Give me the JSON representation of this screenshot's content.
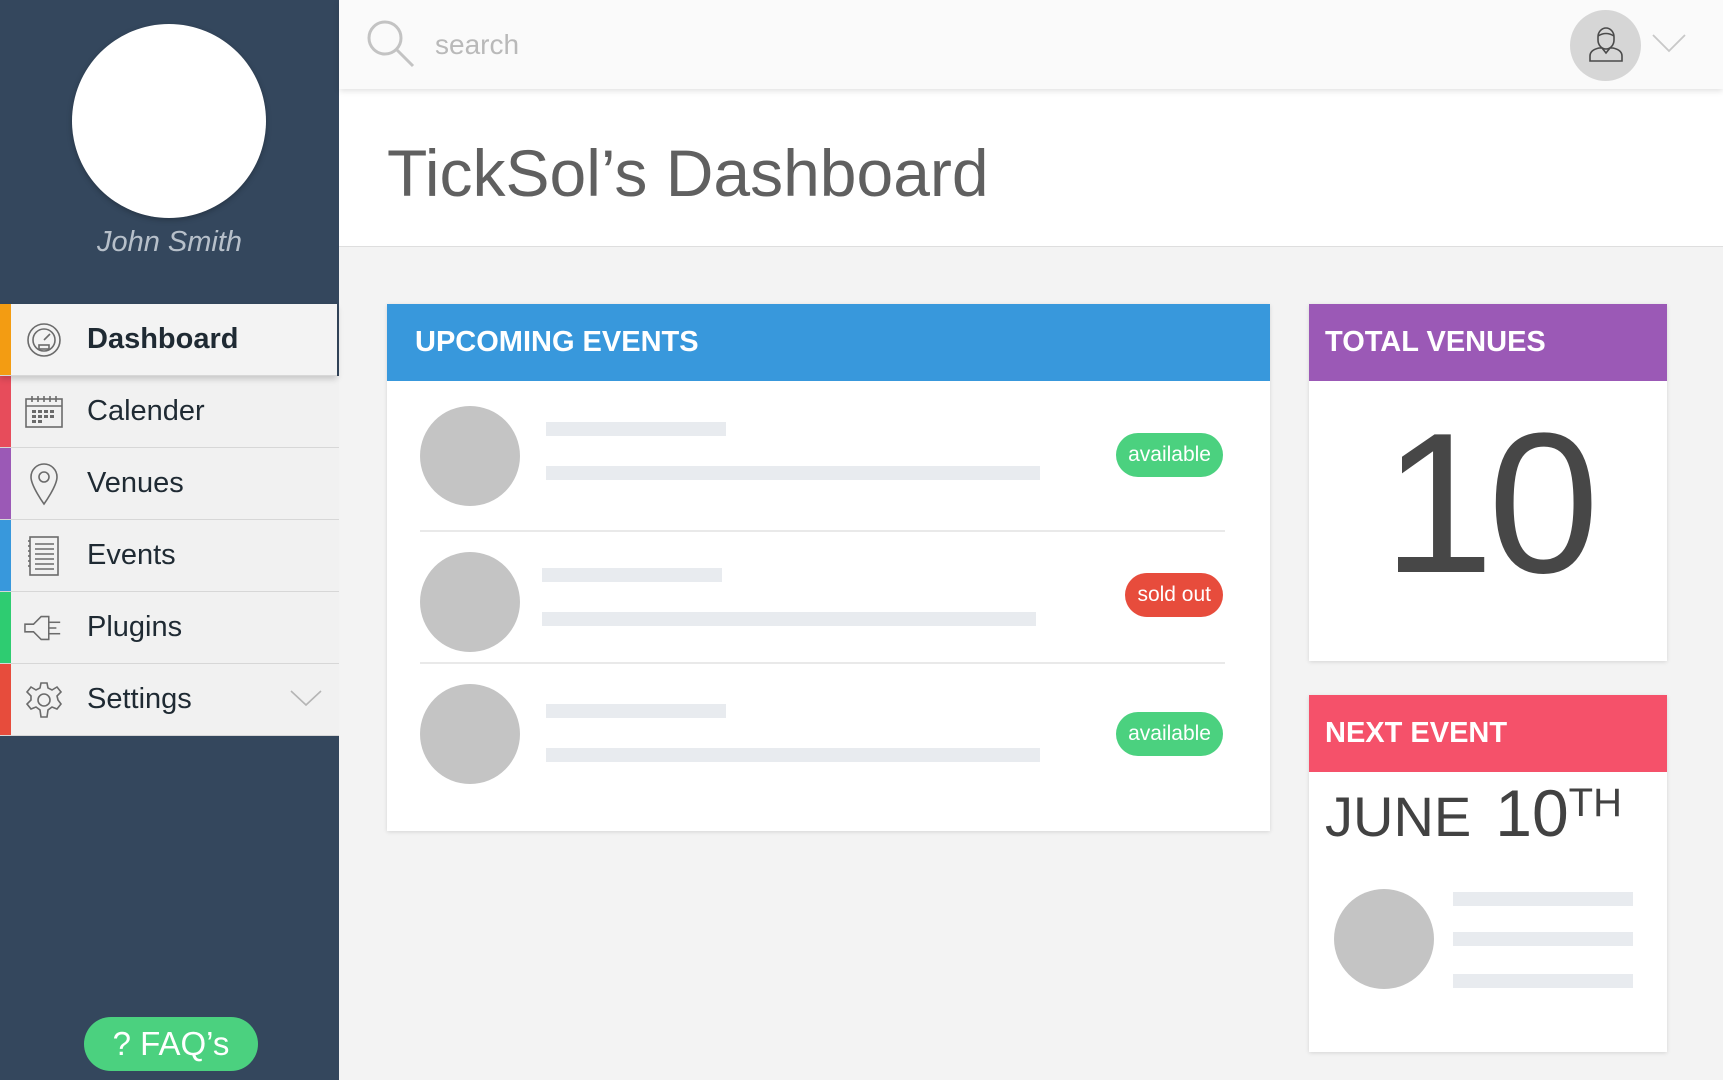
{
  "sidebar": {
    "user_name": "John Smith",
    "nav_items": [
      {
        "label": "Dashboard",
        "icon": "dashboard-gauge-icon",
        "color": "#f39c12",
        "active": true
      },
      {
        "label": "Calender",
        "icon": "calendar-icon",
        "color": "#e74c5b",
        "active": false
      },
      {
        "label": "Venues",
        "icon": "location-pin-icon",
        "color": "#9b59b6",
        "active": false
      },
      {
        "label": "Events",
        "icon": "notepad-icon",
        "color": "#3898dc",
        "active": false
      },
      {
        "label": "Plugins",
        "icon": "plug-icon",
        "color": "#2ecc71",
        "active": false
      },
      {
        "label": "Settings",
        "icon": "gear-icon",
        "color": "#e74c3c",
        "active": false,
        "has_submenu": true
      }
    ],
    "faq_label": "? FAQ’s"
  },
  "topbar": {
    "search_placeholder": "search",
    "user_icon": "user-avatar-icon"
  },
  "page": {
    "title": "TickSol’s Dashboard"
  },
  "upcoming_events": {
    "title": "UPCOMING EVENTS",
    "items": [
      {
        "status": "available",
        "status_color": "#4bd17f"
      },
      {
        "status": "sold out",
        "status_color": "#e74c3c"
      },
      {
        "status": "available",
        "status_color": "#4bd17f"
      }
    ]
  },
  "total_venues": {
    "title": "TOTAL VENUES",
    "value": "10"
  },
  "next_event": {
    "title": "NEXT EVENT",
    "month": "JUNE",
    "day": "10",
    "day_suffix": "TH"
  },
  "colors": {
    "sidebar_bg": "#34475d",
    "upcoming_header": "#3898dc",
    "venues_header": "#9b59b6",
    "next_event_header": "#f5516a",
    "faq_button": "#4bd17f"
  }
}
